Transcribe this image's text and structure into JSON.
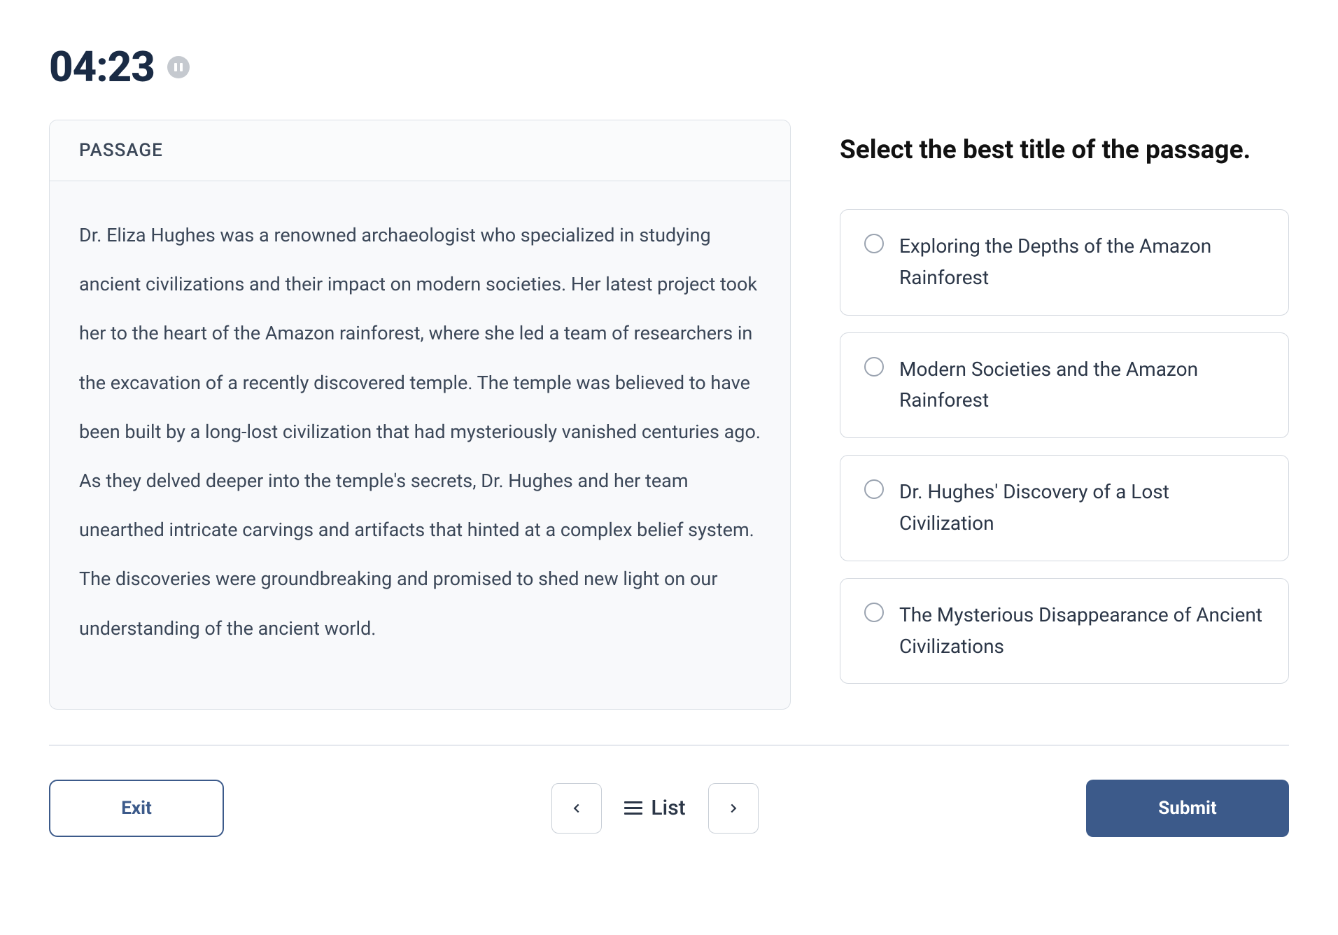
{
  "timer": {
    "value": "04:23"
  },
  "passage": {
    "header": "PASSAGE",
    "body": "Dr. Eliza Hughes was a renowned archaeologist who specialized in studying ancient civilizations and their impact on modern societies. Her latest project took her to the heart of the Amazon rainforest, where she led a team of researchers in the excavation of a recently discovered temple. The temple was believed to have been built by a long-lost civilization that had mysteriously vanished centuries ago. As they delved deeper into the temple's secrets, Dr. Hughes and her team unearthed intricate carvings and artifacts that hinted at a complex belief system. The discoveries were groundbreaking and promised to shed new light on our understanding of the ancient world."
  },
  "question": {
    "prompt": "Select the best title of the passage.",
    "options": [
      "Exploring the Depths of the Amazon Rainforest",
      "Modern Societies and the Amazon Rainforest",
      "Dr. Hughes' Discovery of a Lost Civilization",
      "The Mysterious Disappearance of Ancient Civilizations"
    ]
  },
  "footer": {
    "exit_label": "Exit",
    "list_label": "List",
    "submit_label": "Submit"
  }
}
